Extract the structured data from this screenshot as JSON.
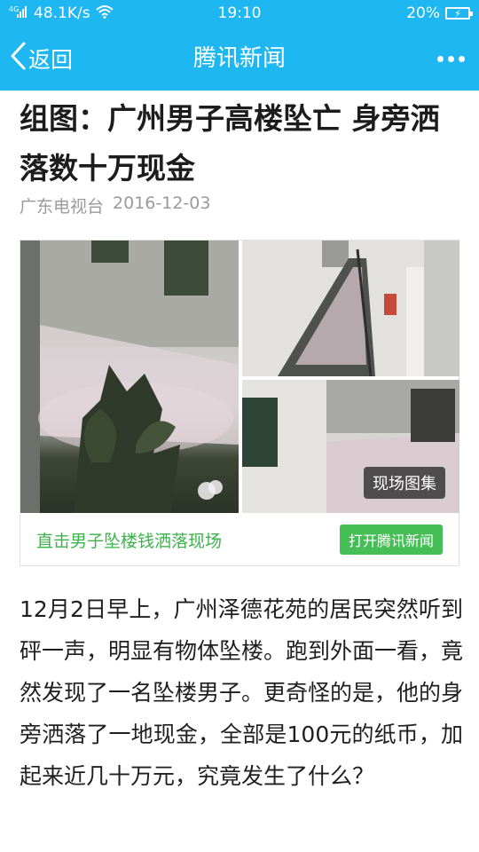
{
  "status_bar": {
    "signal": "4G",
    "speed": "48.1K/s",
    "time": "19:10",
    "battery": "20%",
    "icons": [
      "signal-icon",
      "wifi-icon",
      "battery-charging-icon"
    ]
  },
  "nav": {
    "back_label": "返回",
    "title": "腾讯新闻",
    "icons": [
      "back-arrow-icon",
      "more-dots-icon"
    ]
  },
  "article": {
    "headline": "组图：广州男子高楼坠亡 身旁洒落数十万现金",
    "source": "广东电视台",
    "date": "2016-12-03",
    "gallery": {
      "badge": "现场图集",
      "link_text": "直击男子坠楼钱洒落现场",
      "open_button": "打开腾讯新闻"
    },
    "body": "12月2日早上，广州泽德花苑的居民突然听到砰一声，明显有物体坠楼。跑到外面一看，竟然发现了一名坠楼男子。更奇怪的是，他的身旁洒落了一地现金，全部是100元的纸币，加起来近几十万元，究竟发生了什么？"
  },
  "colors": {
    "header": "#1fb7f2",
    "link_green": "#3bb34a",
    "button_green": "#45be56"
  }
}
